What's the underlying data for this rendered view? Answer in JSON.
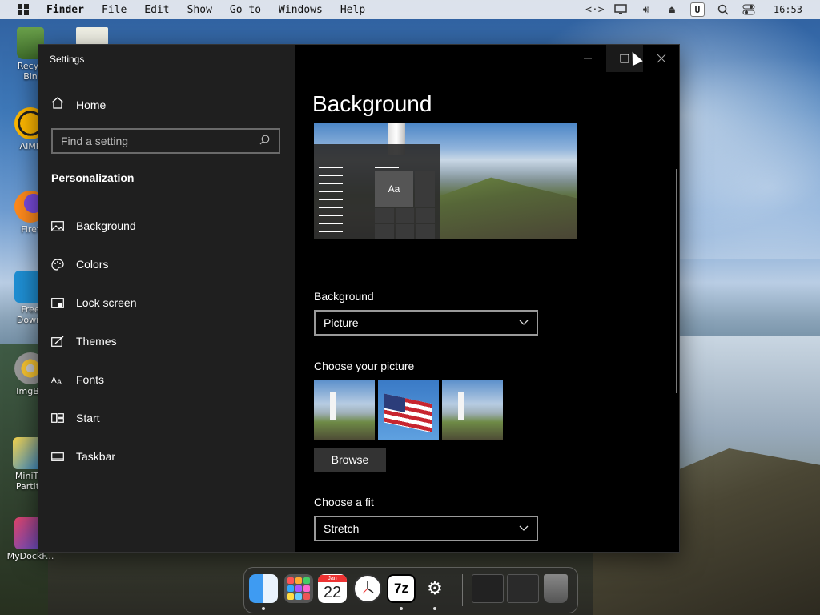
{
  "menubar": {
    "items": [
      "Finder",
      "File",
      "Edit",
      "Show",
      "Go to",
      "Windows",
      "Help"
    ],
    "status_icons": [
      "code-icon",
      "display-icon",
      "volume-icon",
      "eject-icon",
      "u-icon",
      "search-icon",
      "control-center-icon"
    ],
    "u_label": "U",
    "clock": "16:53"
  },
  "desktop": {
    "icons": [
      {
        "label": "Recyc\nBin",
        "icon": "recycle-bin-icon"
      },
      {
        "label": "AIMP",
        "icon": "aimp-icon"
      },
      {
        "label": "Firef",
        "icon": "firefox-icon"
      },
      {
        "label": "Free\nDownl",
        "icon": "free-download-icon"
      },
      {
        "label": "ImgBu",
        "icon": "imgburn-icon"
      },
      {
        "label": "MiniTo\nPartiti",
        "icon": "minitool-partition-icon"
      },
      {
        "label": "MyDockF...",
        "icon": "mydock-icon"
      }
    ]
  },
  "window": {
    "title": "Settings",
    "controls": {
      "minimize": "—",
      "maximize": "☐",
      "close": "✕"
    }
  },
  "sidebar": {
    "home": "Home",
    "search_placeholder": "Find a setting",
    "section": "Personalization",
    "items": [
      {
        "label": "Background",
        "icon": "picture-icon"
      },
      {
        "label": "Colors",
        "icon": "palette-icon"
      },
      {
        "label": "Lock screen",
        "icon": "lock-screen-icon"
      },
      {
        "label": "Themes",
        "icon": "themes-icon"
      },
      {
        "label": "Fonts",
        "icon": "fonts-icon"
      },
      {
        "label": "Start",
        "icon": "start-icon"
      },
      {
        "label": "Taskbar",
        "icon": "taskbar-icon"
      }
    ]
  },
  "content": {
    "title": "Background",
    "preview_tile_text": "Aa",
    "background_label": "Background",
    "background_value": "Picture",
    "choose_picture_label": "Choose your picture",
    "browse_label": "Browse",
    "fit_label": "Choose a fit",
    "fit_value": "Stretch"
  },
  "dock": {
    "apps": [
      "finder-icon",
      "launchpad-icon",
      "calendar-icon",
      "clock-icon",
      "7zip-icon",
      "settings-icon"
    ],
    "calendar_month": "Jan",
    "calendar_day": "22",
    "sevenzip_label": "7z",
    "recent": [
      "window-thumbnail-1",
      "window-thumbnail-2",
      "trash-icon"
    ]
  }
}
